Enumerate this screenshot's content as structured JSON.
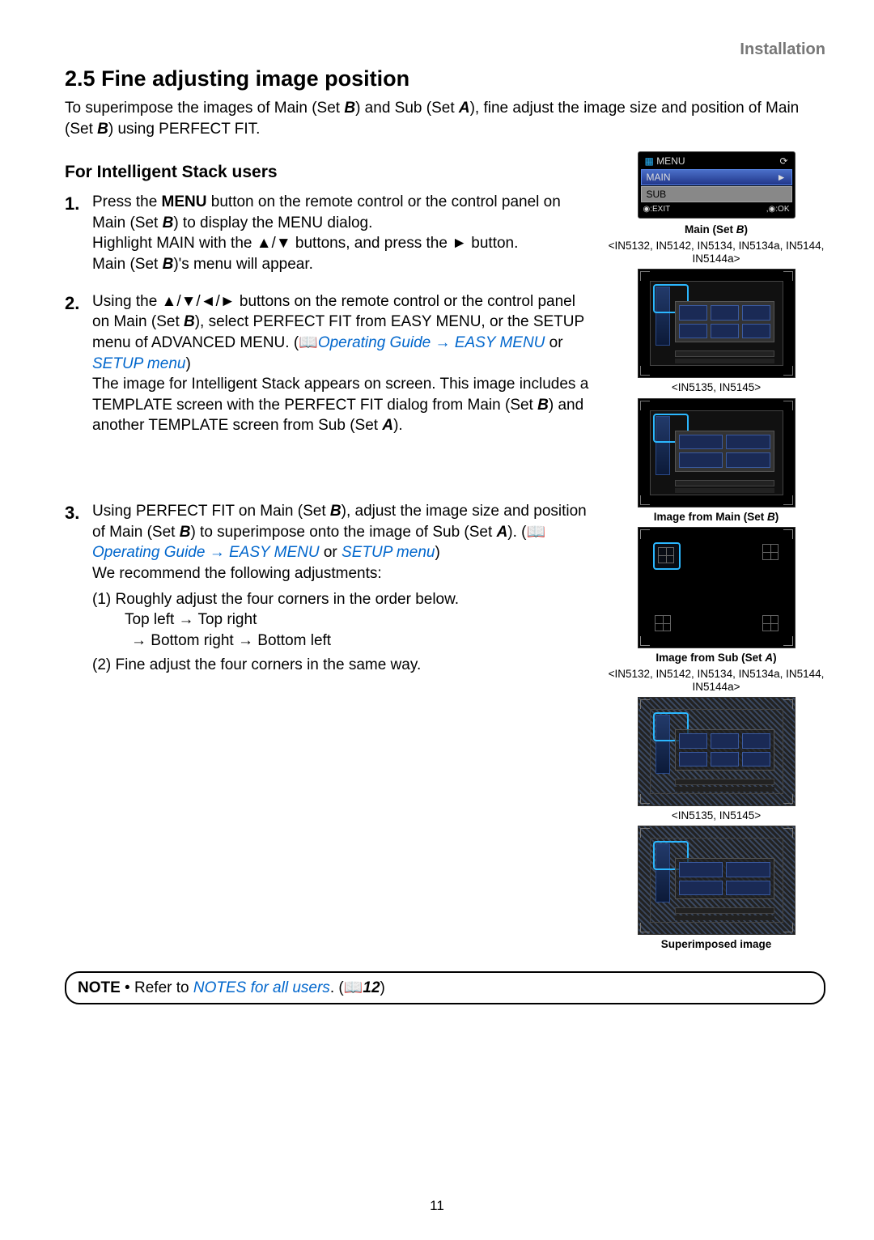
{
  "header": {
    "category": "Installation"
  },
  "section": {
    "number": "2.5",
    "title": "Fine adjusting image position",
    "intro_a": "To superimpose the images of Main (Set ",
    "intro_b": ") and Sub (Set ",
    "intro_c": "), fine adjust the image size and position of Main (Set ",
    "intro_d": ") using PERFECT FIT.",
    "set_b": "B",
    "set_a": "A"
  },
  "subhead": "For Intelligent Stack users",
  "steps": {
    "s1": {
      "num": "1.",
      "p1a": "Press the ",
      "p1b": "MENU",
      "p1c": " button on the remote control or the control panel on Main (Set ",
      "p1d": ") to display the MENU dialog.",
      "p2": "Highlight MAIN with the ▲/▼ buttons, and press the ► button.",
      "p3a": "Main (Set ",
      "p3b": ")'s menu will appear."
    },
    "s2": {
      "num": "2.",
      "p1a": "Using the ▲/▼/◄/► buttons on the remote control or the control panel on Main (Set ",
      "p1b": "), select PERFECT FIT from EASY MENU, or the SETUP menu of ADVANCED MENU. (",
      "opguide": "Operating Guide",
      "arrow": " → ",
      "easy": "EASY MENU",
      "or": " or ",
      "setup": "SETUP menu",
      "close": ")",
      "p2": "The image for Intelligent Stack appears on screen. This image includes a TEMPLATE screen with the PERFECT FIT dialog from Main (Set ",
      "p2b": ") and another TEMPLATE screen from Sub (Set ",
      "p2c": ")."
    },
    "s3": {
      "num": "3.",
      "p1a": "Using PERFECT FIT on Main (Set ",
      "p1b": "), adjust the image size and position of Main (Set ",
      "p1c": ") to superimpose onto the image of Sub (Set ",
      "p1d": "). (",
      "opguide": "Operating Guide",
      "arrow": " → ",
      "easy": "EASY MENU",
      "or": " or ",
      "setup": "SETUP menu",
      "close": ")",
      "p2": "We recommend the following adjustments:",
      "p3": "(1) Roughly adjust the four corners in the order below.",
      "p4": "Top left → Top right",
      "p5": "→ Bottom right → Bottom left",
      "p6": "(2) Fine adjust the four corners in the same way."
    }
  },
  "menu": {
    "title": "MENU",
    "main": "MAIN",
    "sub": "SUB",
    "exit": "◉:EXIT",
    "ok": ",◉:OK",
    "arrow": "►"
  },
  "captions": {
    "main_set_b": "Main (Set B)",
    "models_a": "<IN5132, IN5142, IN5134, IN5134a, IN5144, IN5144a>",
    "models_b": "<IN5135, IN5145>",
    "img_main": "Image from Main (Set B)",
    "img_sub": "Image from Sub (Set A)",
    "superimposed": "Superimposed image"
  },
  "note": {
    "label": "NOTE",
    "bullet": " • ",
    "text1": "Refer to ",
    "link": "NOTES for all users",
    "text2": ". (",
    "pg": "12",
    "close": ")"
  },
  "pagenum": "11",
  "icons": {
    "book": "📖"
  }
}
